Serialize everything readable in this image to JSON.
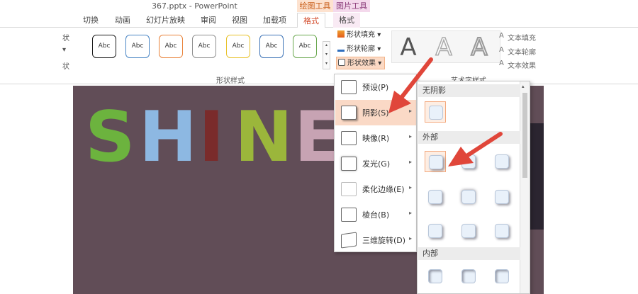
{
  "title": {
    "text": "367.pptx - PowerPoint"
  },
  "context_groups": {
    "drawing_tools": "绘图工具",
    "picture_tools": "图片工具"
  },
  "tabs": [
    "切换",
    "动画",
    "幻灯片放映",
    "审阅",
    "视图",
    "加载项",
    "格式",
    "格式"
  ],
  "active_tab_index": 6,
  "left_fragments": [
    "状",
    "▾",
    "状"
  ],
  "shape_styles": {
    "preset_label": "Abc",
    "preset_border_colors": [
      "#1a1a1a",
      "#4a86c5",
      "#e9833b",
      "#8f8f8f",
      "#e8c22b",
      "#3e74b7",
      "#6aa84f"
    ],
    "group_label": "形状样式",
    "fill": "形状填充",
    "outline": "形状轮廓",
    "effects": "形状效果",
    "dropdown_glyph": "▾",
    "gallery_scroll": [
      "▴",
      "▾",
      "▾"
    ]
  },
  "wordart": {
    "glyph": "A",
    "group_label": "艺术字样式",
    "text_fill": "文本填充",
    "text_outline": "文本轮廓",
    "text_effects": "文本效果"
  },
  "slide": {
    "background": "#614d57",
    "letters": [
      "S",
      "H",
      "I",
      "N",
      "E"
    ]
  },
  "effects_menu": {
    "items": [
      {
        "label": "预设(P)",
        "arrow": ""
      },
      {
        "label": "阴影(S)",
        "arrow": "▸"
      },
      {
        "label": "映像(R)",
        "arrow": "▸"
      },
      {
        "label": "发光(G)",
        "arrow": "▸"
      },
      {
        "label": "柔化边缘(E)",
        "arrow": "▸"
      },
      {
        "label": "棱台(B)",
        "arrow": "▸"
      },
      {
        "label": "三维旋转(D)",
        "arrow": "▸"
      }
    ],
    "highlighted_index": 1
  },
  "shadow_submenu": {
    "no_shadow": "无阴影",
    "outer": "外部",
    "inner": "内部",
    "scroll_up": "▴"
  },
  "colors": {
    "accent": "#d24726",
    "highlight": "#fad9c6",
    "arrow": "#e0463a"
  }
}
